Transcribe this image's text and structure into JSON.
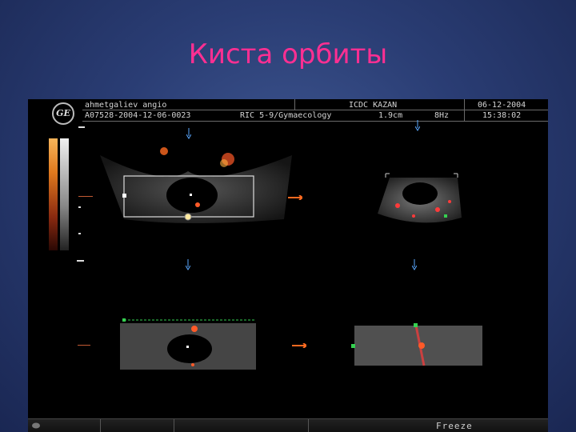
{
  "slide": {
    "title": "Киста орбиты"
  },
  "header": {
    "patient": "ahmetgaliev  angio",
    "exam_id": "A07528-2004-12-06-0023",
    "probe": "RIC 5-9/Gymaecology",
    "site": "ICDC KAZAN",
    "depth": "1.9cm",
    "frequency": "8Hz",
    "date": "06-12-2004",
    "time": "15:38:02"
  },
  "status": {
    "freeze_label": "Freeze"
  },
  "icons": {
    "logo": "ge-logo",
    "marker": "orange-arrow-marker",
    "cursor": "blue-down-arrow"
  },
  "colors": {
    "title": "#ff2f92",
    "doppler": "#ff5a28",
    "background": "#2a3d74"
  }
}
